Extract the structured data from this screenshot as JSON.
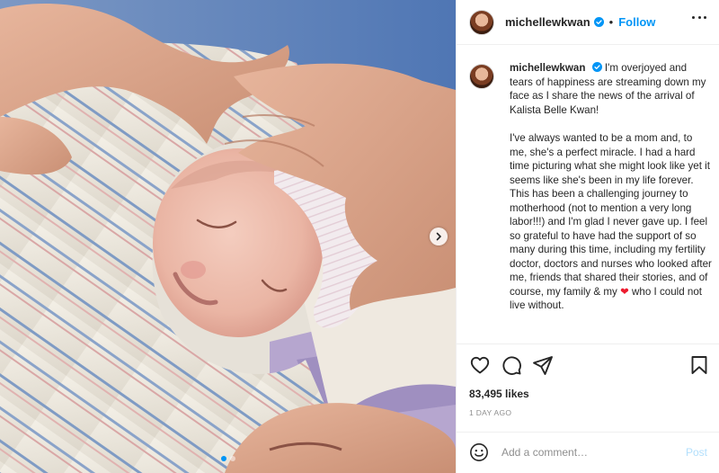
{
  "post": {
    "image": {
      "description": "newborn baby swaddled in striped hospital blanket with hands touching her head",
      "slide_count": 2,
      "active_slide": 1
    },
    "header": {
      "username": "michellewkwan",
      "separator": "•",
      "follow_label": "Follow"
    },
    "caption": {
      "username": "michellewkwan",
      "paragraph_1": "I'm overjoyed and tears of happiness are streaming down my face as I share the news of the arrival of Kalista Belle Kwan!",
      "paragraph_2_start": "I've always wanted to be a mom and, to me, she's a perfect miracle. I had a hard time picturing what she might look like yet it seems like she's been in my life forever. This has been a challenging journey to motherhood (not to mention a very long labor!!!) and I'm glad I never gave up. I feel so grateful to have had the support of so many during this time, including my fertility doctor, doctors and nurses who looked after me, friends that shared their stories, and of course, my family & my",
      "heart_emoji": "❤",
      "paragraph_2_end": "who I could not live without."
    },
    "likes": "83,495 likes",
    "timestamp": "1 DAY AGO",
    "comment": {
      "placeholder": "Add a comment…",
      "post_label": "Post"
    },
    "icons": [
      "verified-badge-icon",
      "more-options-icon",
      "heart-icon",
      "comment-icon",
      "share-icon",
      "bookmark-icon",
      "emoji-icon",
      "chevron-right-icon"
    ],
    "colors": {
      "accent": "#0095f6",
      "post_disabled": "#b2dffc",
      "heart": "#ed1b2e",
      "meta": "#8e8e8e"
    }
  }
}
